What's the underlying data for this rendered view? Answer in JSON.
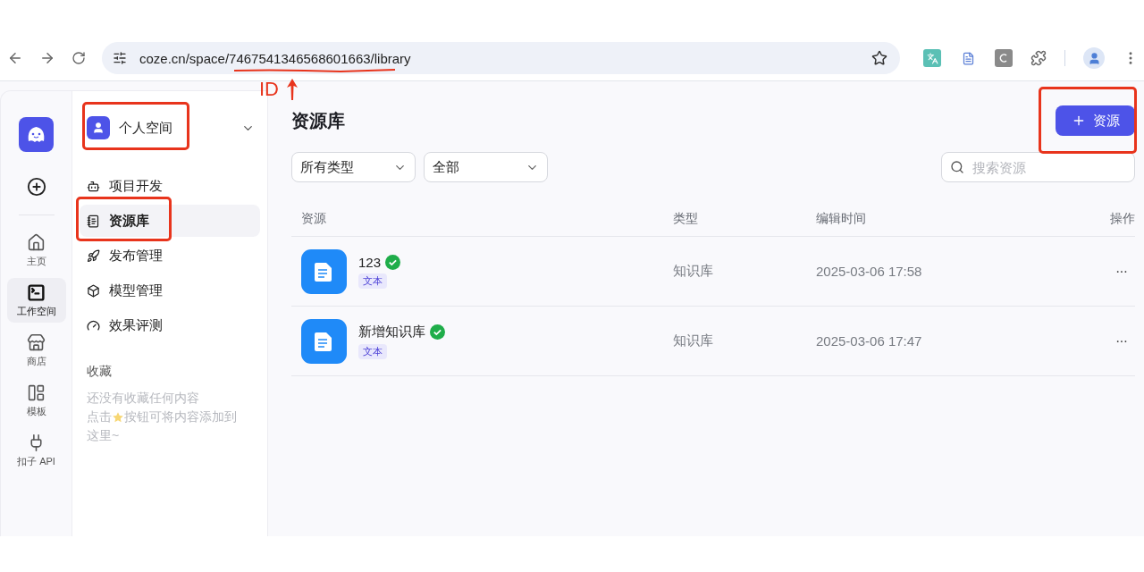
{
  "browser": {
    "address": "coze.cn/space/7467541346568601663/library",
    "id_highlighted": true,
    "annotation_label": "ID"
  },
  "rail": {
    "items": [
      {
        "label": "主页",
        "selected": false
      },
      {
        "label": "工作空间",
        "selected": true
      },
      {
        "label": "商店",
        "selected": false
      },
      {
        "label": "模板",
        "selected": false
      },
      {
        "label": "扣子 API",
        "selected": false
      }
    ]
  },
  "sidebar": {
    "workspace": {
      "name": "个人空间",
      "highlighted": true
    },
    "items": [
      {
        "label": "项目开发",
        "selected": false,
        "highlighted": false
      },
      {
        "label": "资源库",
        "selected": true,
        "highlighted": true
      },
      {
        "label": "发布管理",
        "selected": false,
        "highlighted": false
      },
      {
        "label": "模型管理",
        "selected": false,
        "highlighted": false
      },
      {
        "label": "效果评测",
        "selected": false,
        "highlighted": false
      }
    ],
    "favorites": {
      "title": "收藏",
      "empty_line": "还没有收藏任何内容",
      "hint_before": "点击",
      "hint_after": "按钮可将内容添加到",
      "hint_end": "这里~"
    }
  },
  "main": {
    "title": "资源库",
    "create_button": {
      "label": "资源",
      "highlighted": true
    },
    "filters": [
      "所有类型",
      "全部"
    ],
    "search": {
      "placeholder": "搜索资源"
    },
    "table": {
      "columns": [
        "资源",
        "类型",
        "编辑时间",
        "操作"
      ],
      "rows": [
        {
          "name": "123",
          "verified": true,
          "tag": "文本",
          "type": "知识库",
          "edited": "2025-03-06 17:58",
          "actions": "···"
        },
        {
          "name": "新增知识库",
          "verified": true,
          "tag": "文本",
          "type": "知识库",
          "edited": "2025-03-06 17:47",
          "actions": "···"
        }
      ]
    }
  }
}
